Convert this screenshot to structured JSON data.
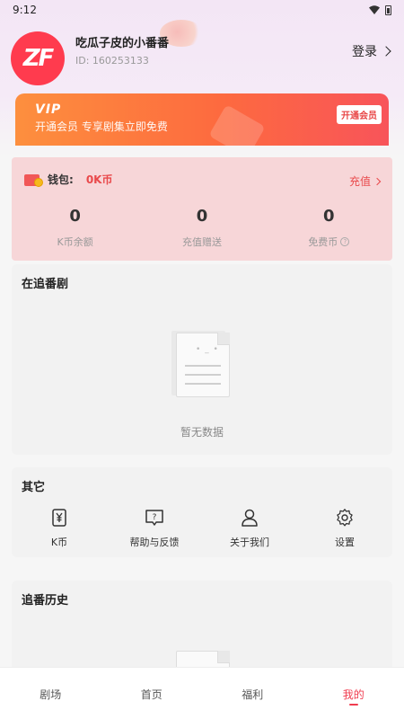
{
  "status_bar": {
    "time": "9:12"
  },
  "profile": {
    "avatar_text": "ZF",
    "nickname": "吃瓜子皮的小番番",
    "id": "ID: 160253133",
    "login_label": "登录"
  },
  "vip": {
    "logo": "VIP",
    "text": "开通会员   专享剧集立即免费",
    "button": "开通会员"
  },
  "wallet": {
    "label": "钱包:",
    "amount": "0K币",
    "recharge": "充值",
    "stats": [
      {
        "value": "0",
        "name": "K币余额"
      },
      {
        "value": "0",
        "name": "充值赠送"
      },
      {
        "value": "0",
        "name": "免费币"
      }
    ]
  },
  "following": {
    "title": "在追番剧",
    "empty_text": "暂无数据"
  },
  "others": {
    "title": "其它",
    "items": [
      {
        "label": "K币",
        "icon": "k-coin-icon"
      },
      {
        "label": "帮助与反馈",
        "icon": "help-feedback-icon"
      },
      {
        "label": "关于我们",
        "icon": "user-icon"
      },
      {
        "label": "设置",
        "icon": "gear-icon"
      }
    ]
  },
  "history": {
    "title": "追番历史"
  },
  "nav": {
    "tabs": [
      {
        "label": "剧场"
      },
      {
        "label": "首页"
      },
      {
        "label": "福利"
      },
      {
        "label": "我的"
      }
    ],
    "active_index": 3
  },
  "colors": {
    "accent": "#f03c4f",
    "wallet_bg": "#f7d6d8",
    "vip_start": "#fd8f3e",
    "vip_end": "#f8545a"
  }
}
